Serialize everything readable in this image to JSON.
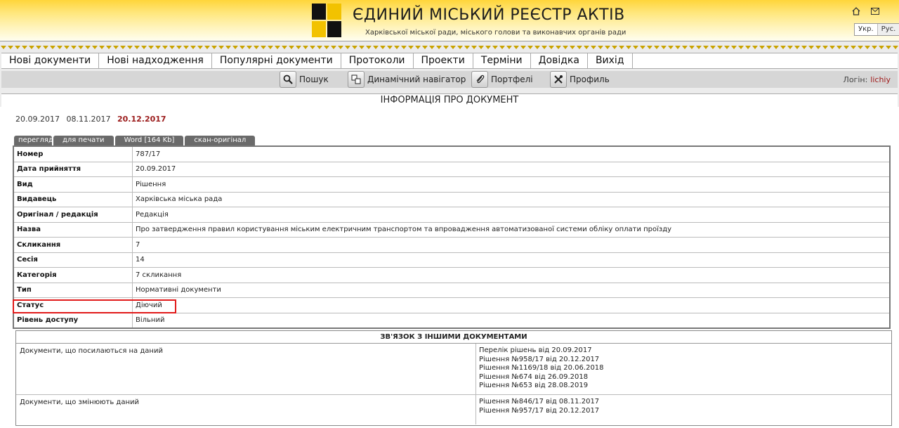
{
  "header": {
    "title": "ЄДИНИЙ МІСЬКИЙ РЕЄСТР АКТІВ",
    "subtitle": "Харківської міської ради, міського голови та виконавчих органів ради",
    "lang": [
      "Укр.",
      "Рус."
    ]
  },
  "menu": [
    "Нові документи",
    "Нові надходження",
    "Популярні документи",
    "Протоколи",
    "Проекти",
    "Терміни",
    "Довідка",
    "Вихід"
  ],
  "toolbar": {
    "search": "Пошук",
    "navigator": "Динамічний навігатор",
    "portfolio": "Портфелі",
    "profile": "Профиль",
    "login_label": "Логін:",
    "login_user": "lichiy"
  },
  "info_header": "ІНФОРМАЦІЯ ПРО ДОКУМЕНТ",
  "dates": {
    "d1": "20.09.2017",
    "d2": "08.11.2017",
    "current": "20.12.2017"
  },
  "tabs": [
    "перегляд",
    "для печати",
    "Word [164 Kb]",
    "скан-оригінал"
  ],
  "fields": [
    {
      "k": "Номер",
      "v": "787/17"
    },
    {
      "k": "Дата прийняття",
      "v": "20.09.2017"
    },
    {
      "k": "Вид",
      "v": "Рішення"
    },
    {
      "k": "Видавець",
      "v": "Харківська міська рада"
    },
    {
      "k": "Оригінал / редакція",
      "v": "Редакція"
    },
    {
      "k": "Назва",
      "v": "Про затвердження правил користування міським електричним транспортом та впровадження автоматизованої системи обліку оплати проїзду"
    },
    {
      "k": "Скликання",
      "v": "7"
    },
    {
      "k": "Сесія",
      "v": "14"
    },
    {
      "k": "Категорія",
      "v": "7 скликання"
    },
    {
      "k": "Тип",
      "v": "Нормативні документи"
    },
    {
      "k": "Статус",
      "v": "Діючий"
    },
    {
      "k": "Рівень доступу",
      "v": "Вільний"
    }
  ],
  "relations": {
    "title": "ЗВ'ЯЗОК З ІНШИМИ ДОКУМЕНТАМИ",
    "referring_label": "Документи, що посилаються на даний",
    "referring": [
      "Перелік рішень від 20.09.2017",
      "Рішення №958/17 від 20.12.2017",
      "Рішення №1169/18 від 20.06.2018",
      "Рішення №674 від 26.09.2018",
      "Рішення №653 від 28.08.2019"
    ],
    "modifying_label": "Документи, що змінюють даний",
    "modifying": [
      "Рішення №846/17 від 08.11.2017",
      "Рішення №957/17 від 20.12.2017"
    ]
  },
  "icons": {
    "home": "home-icon",
    "mail": "mail-icon",
    "search": "magnifier-icon",
    "navigator": "navigator-icon",
    "portfolio": "paperclip-icon",
    "profile": "tools-icon"
  },
  "colors": {
    "header_yellow": "#ffd53a",
    "status_highlight": "#e11a1a",
    "date_current": "#9b1b1b",
    "tab_bg": "#6a6a6a"
  }
}
